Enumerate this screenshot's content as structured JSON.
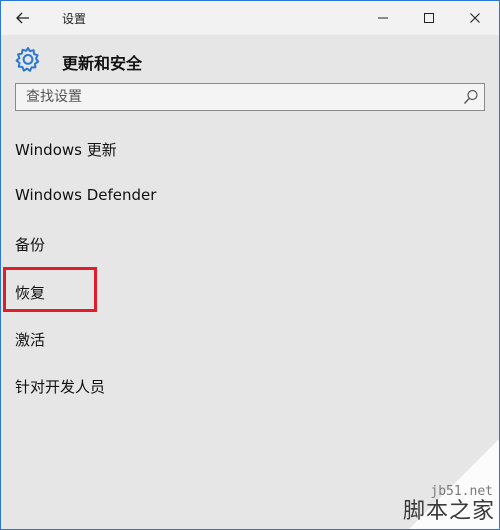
{
  "window": {
    "title": "设置"
  },
  "header": {
    "title": "更新和安全"
  },
  "search": {
    "placeholder": "查找设置"
  },
  "nav": {
    "items": [
      {
        "label": "Windows 更新"
      },
      {
        "label": "Windows Defender"
      },
      {
        "label": "备份"
      },
      {
        "label": "恢复"
      },
      {
        "label": "激活"
      },
      {
        "label": "针对开发人员"
      }
    ]
  },
  "watermark": {
    "url": "jb51.net",
    "site": "脚本之家"
  },
  "colors": {
    "accent": "#2b78d4",
    "highlight": "#e01e2a",
    "background": "#e6e6e6",
    "titlebar": "#f2f2f2"
  }
}
